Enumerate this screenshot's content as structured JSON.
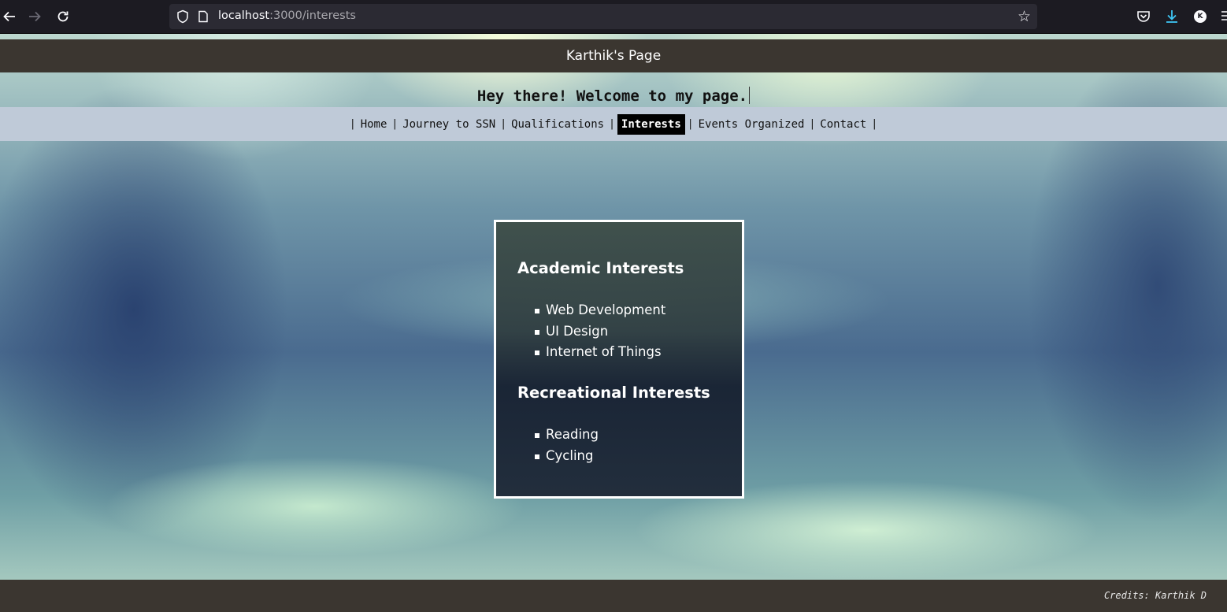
{
  "browser": {
    "url_host": "localhost",
    "url_path": ":3000/interests",
    "profile_initial": "K"
  },
  "site": {
    "header_title": "Karthik's Page",
    "welcome": "Hey there! Welcome to my page."
  },
  "nav": {
    "items": [
      "Home",
      "Journey to SSN",
      "Qualifications",
      "Interests",
      "Events Organized",
      "Contact"
    ],
    "separator": "|",
    "active": "Interests"
  },
  "interests": {
    "academic_heading": "Academic Interests",
    "academic": [
      "Web Development",
      "UI Design",
      "Internet of Things"
    ],
    "recreational_heading": "Recreational Interests",
    "recreational": [
      "Reading",
      "Cycling"
    ]
  },
  "footer": {
    "credits": "Credits: Karthik D"
  }
}
